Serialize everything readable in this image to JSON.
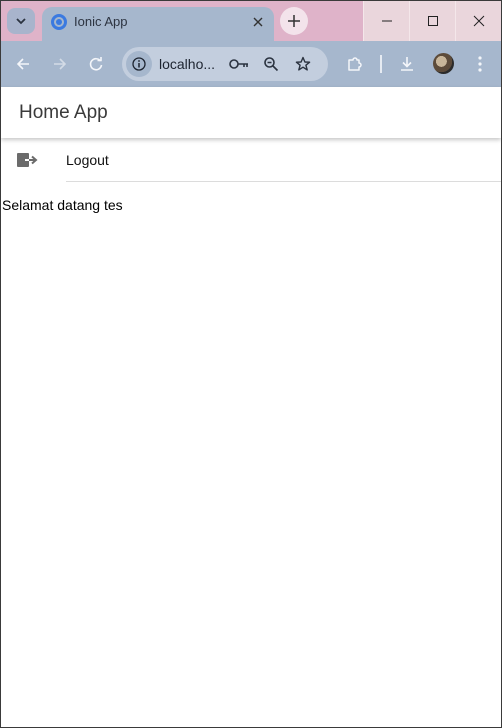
{
  "browser": {
    "tab": {
      "title": "Ionic App"
    },
    "url": "localho...",
    "colors": {
      "tabstrip": "#dfb3c9",
      "toolbar": "#a6b7cd",
      "omnibox": "#c3cede"
    }
  },
  "app": {
    "header": {
      "title": "Home App"
    },
    "menu": [
      {
        "label": "Logout",
        "icon": "logout-icon"
      }
    ],
    "content": {
      "welcome_text": "Selamat datang tes"
    }
  }
}
